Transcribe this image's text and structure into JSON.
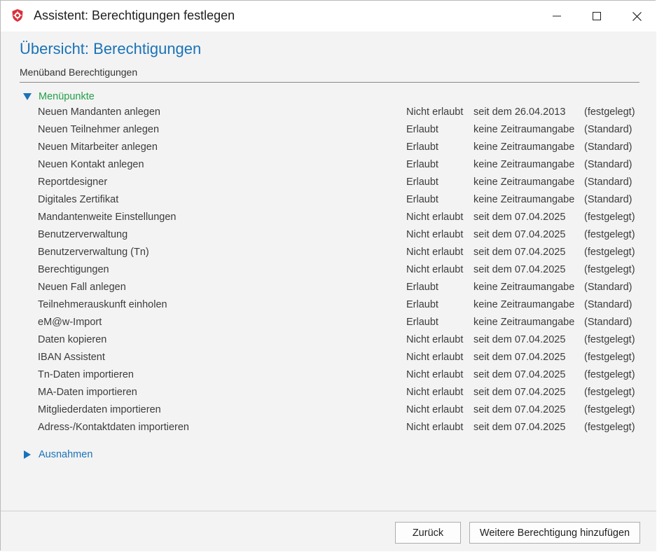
{
  "window": {
    "title": "Assistent: Berechtigungen festlegen",
    "controls": [
      "minimize",
      "maximize",
      "close"
    ]
  },
  "page": {
    "title": "Übersicht: Berechtigungen",
    "subtitle": "Menüband Berechtigungen"
  },
  "sections": {
    "menu": {
      "label": "Menüpunkte",
      "expanded": true
    },
    "exceptions": {
      "label": "Ausnahmen",
      "expanded": false
    }
  },
  "permissions": [
    {
      "name": "Neuen Mandanten anlegen",
      "status": "Nicht erlaubt",
      "period": "seit dem 26.04.2013",
      "kind": "(festgelegt)"
    },
    {
      "name": "Neuen Teilnehmer anlegen",
      "status": "Erlaubt",
      "period": "keine Zeitraumangabe",
      "kind": "(Standard)"
    },
    {
      "name": "Neuen Mitarbeiter anlegen",
      "status": "Erlaubt",
      "period": "keine Zeitraumangabe",
      "kind": "(Standard)"
    },
    {
      "name": "Neuen Kontakt anlegen",
      "status": "Erlaubt",
      "period": "keine Zeitraumangabe",
      "kind": "(Standard)"
    },
    {
      "name": "Reportdesigner",
      "status": "Erlaubt",
      "period": "keine Zeitraumangabe",
      "kind": "(Standard)"
    },
    {
      "name": "Digitales Zertifikat",
      "status": "Erlaubt",
      "period": "keine Zeitraumangabe",
      "kind": "(Standard)"
    },
    {
      "name": "Mandantenweite Einstellungen",
      "status": "Nicht erlaubt",
      "period": "seit dem 07.04.2025",
      "kind": "(festgelegt)"
    },
    {
      "name": "Benutzerverwaltung",
      "status": "Nicht erlaubt",
      "period": "seit dem 07.04.2025",
      "kind": "(festgelegt)"
    },
    {
      "name": "Benutzerverwaltung (Tn)",
      "status": "Nicht erlaubt",
      "period": "seit dem 07.04.2025",
      "kind": "(festgelegt)"
    },
    {
      "name": "Berechtigungen",
      "status": "Nicht erlaubt",
      "period": "seit dem 07.04.2025",
      "kind": "(festgelegt)"
    },
    {
      "name": "Neuen Fall anlegen",
      "status": "Erlaubt",
      "period": "keine Zeitraumangabe",
      "kind": "(Standard)"
    },
    {
      "name": "Teilnehmerauskunft einholen",
      "status": "Erlaubt",
      "period": "keine Zeitraumangabe",
      "kind": "(Standard)"
    },
    {
      "name": "eM@w-Import",
      "status": "Erlaubt",
      "period": "keine Zeitraumangabe",
      "kind": "(Standard)"
    },
    {
      "name": "Daten kopieren",
      "status": "Nicht erlaubt",
      "period": "seit dem 07.04.2025",
      "kind": "(festgelegt)"
    },
    {
      "name": "IBAN Assistent",
      "status": "Nicht erlaubt",
      "period": "seit dem 07.04.2025",
      "kind": "(festgelegt)"
    },
    {
      "name": "Tn-Daten importieren",
      "status": "Nicht erlaubt",
      "period": "seit dem 07.04.2025",
      "kind": "(festgelegt)"
    },
    {
      "name": "MA-Daten importieren",
      "status": "Nicht erlaubt",
      "period": "seit dem 07.04.2025",
      "kind": "(festgelegt)"
    },
    {
      "name": "Mitgliederdaten importieren",
      "status": "Nicht erlaubt",
      "period": "seit dem 07.04.2025",
      "kind": "(festgelegt)"
    },
    {
      "name": "Adress-/Kontaktdaten importieren",
      "status": "Nicht erlaubt",
      "period": "seit dem 07.04.2025",
      "kind": "(festgelegt)"
    }
  ],
  "footer": {
    "back_label": "Zurück",
    "add_label": "Weitere Berechtigung hinzufügen"
  },
  "colors": {
    "accent_blue": "#1a73b8",
    "section_green": "#22a04a",
    "app_icon_red": "#d9303b"
  },
  "icons": {
    "app": "shield-gear-icon",
    "expanded": "triangle-down-icon",
    "collapsed": "triangle-right-icon"
  }
}
